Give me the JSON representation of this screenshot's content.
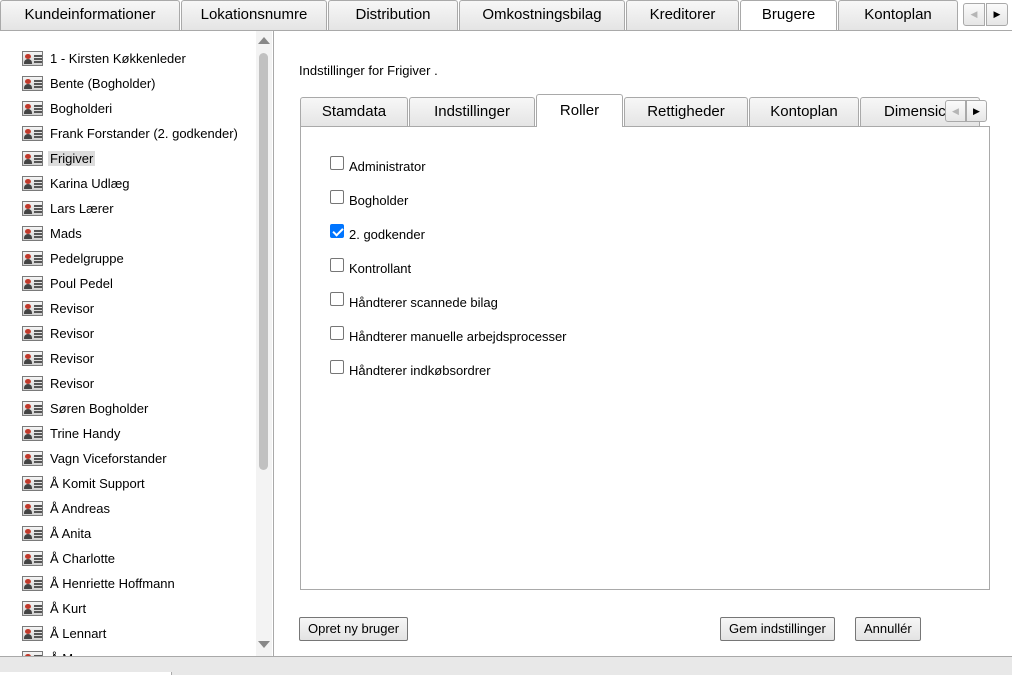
{
  "top_tabs": [
    {
      "label": "Kundeinformationer"
    },
    {
      "label": "Lokationsnumre"
    },
    {
      "label": "Distribution"
    },
    {
      "label": "Omkostningsbilag"
    },
    {
      "label": "Kreditorer"
    },
    {
      "label": "Brugere",
      "active": true
    },
    {
      "label": "Kontoplan"
    }
  ],
  "users": [
    "1 - Kirsten Køkkenleder",
    "Bente (Bogholder)",
    "Bogholderi",
    "Frank Forstander (2. godkender)",
    "Frigiver",
    "Karina Udlæg",
    "Lars Lærer",
    "Mads",
    "Pedelgruppe",
    "Poul Pedel",
    "Revisor",
    "Revisor",
    "Revisor",
    "Revisor",
    "Søren Bogholder",
    "Trine Handy",
    "Vagn Viceforstander",
    "Å Komit Support",
    "Å Andreas",
    "Å Anita",
    "Å Charlotte",
    "Å Henriette Hoffmann",
    "Å Kurt",
    "Å Lennart",
    "Å M..."
  ],
  "selected_user": "Frigiver",
  "settings": {
    "title": "Indstillinger for Frigiver ."
  },
  "inner_tabs": [
    {
      "label": "Stamdata"
    },
    {
      "label": "Indstillinger"
    },
    {
      "label": "Roller",
      "active": true
    },
    {
      "label": "Rettigheder"
    },
    {
      "label": "Kontoplan"
    },
    {
      "label": "Dimensic"
    }
  ],
  "roles": [
    {
      "label": "Administrator",
      "checked": false
    },
    {
      "label": "Bogholder",
      "checked": false
    },
    {
      "label": "2. godkender",
      "checked": true
    },
    {
      "label": "Kontrollant",
      "checked": false
    },
    {
      "label": "Håndterer scannede bilag",
      "checked": false
    },
    {
      "label": "Håndterer manuelle arbejdsprocesser",
      "checked": false
    },
    {
      "label": "Håndterer indkøbsordrer",
      "checked": false
    }
  ],
  "buttons": {
    "create_user": "Opret ny bruger",
    "save": "Gem indstillinger",
    "cancel": "Annullér"
  },
  "icons": {
    "scroll_left": "◀",
    "scroll_right": "▶"
  },
  "colors": {
    "checkbox_accent": "#0075ff",
    "selected_item_bg": "#dcdcdc",
    "border": "#a9a9a9"
  }
}
